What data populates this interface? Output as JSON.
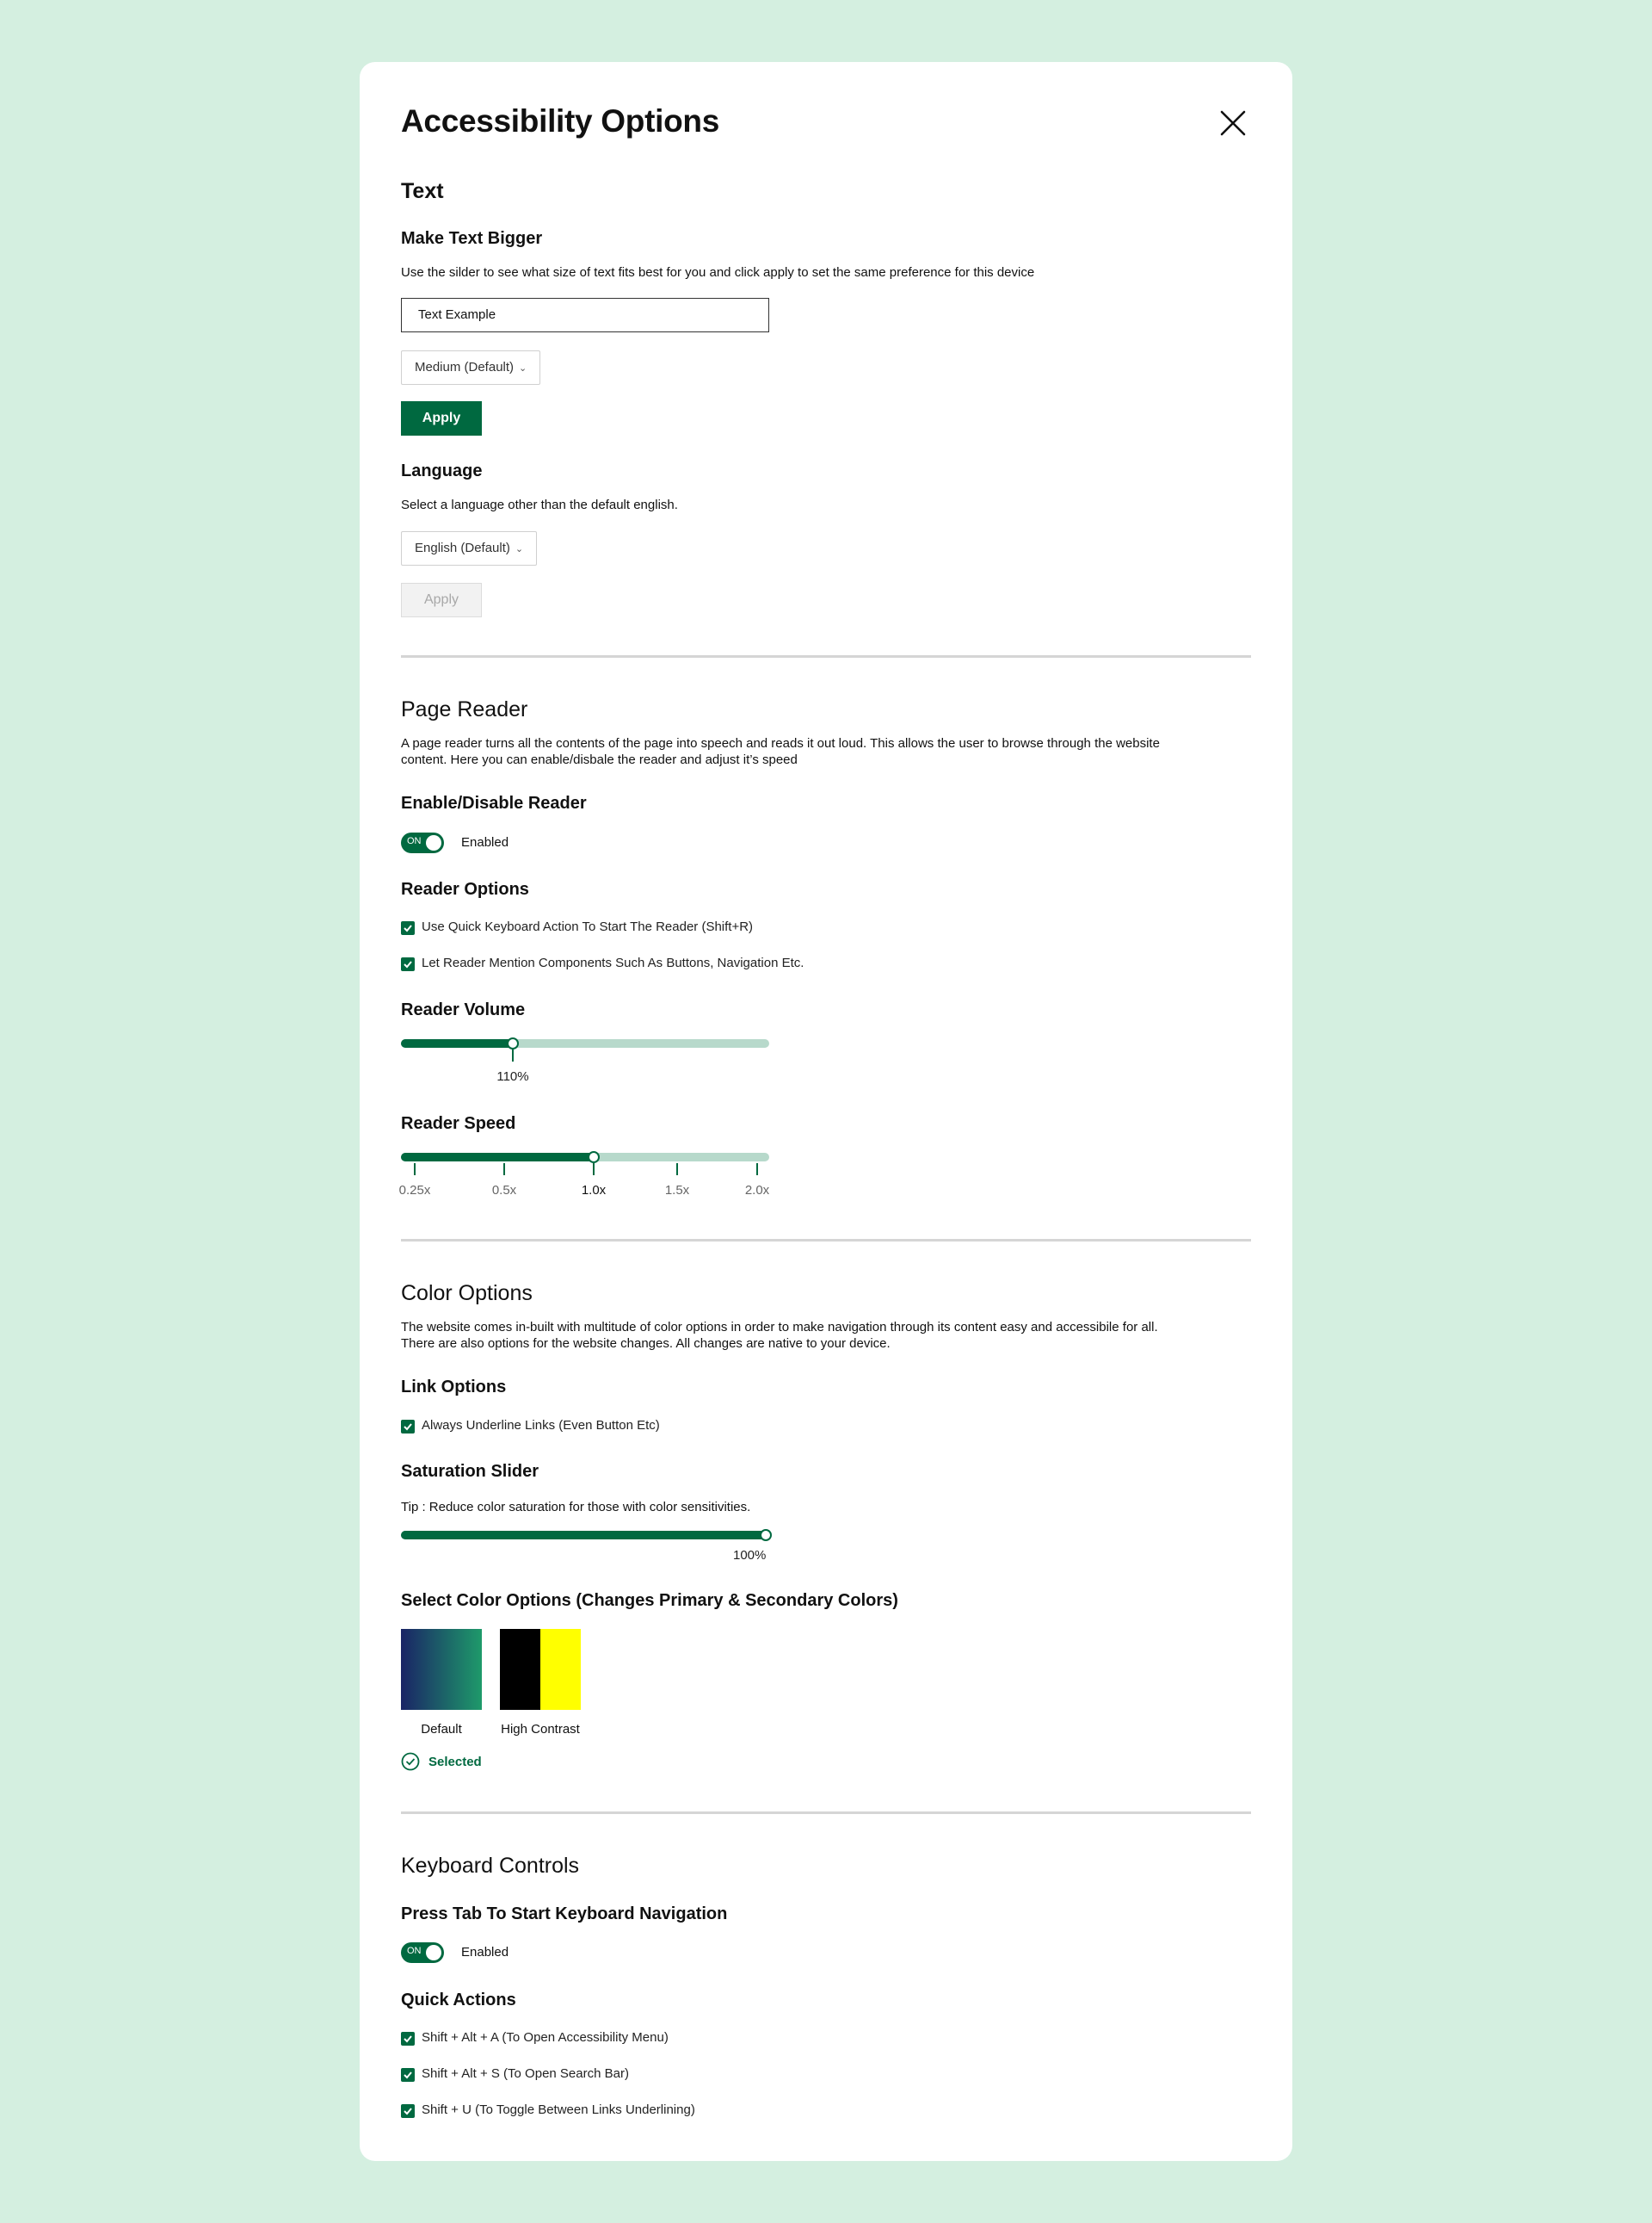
{
  "dialog": {
    "title": "Accessibility Options",
    "close_icon": "close-icon"
  },
  "text_section": {
    "heading": "Text",
    "bigger": {
      "heading": "Make Text Bigger",
      "description": "Use the silder to see what size of text fits best for you and click apply to set the same preference for this device",
      "example_value": "Text Example",
      "size_select": "Medium (Default)",
      "apply_label": "Apply"
    },
    "language": {
      "heading": "Language",
      "description": "Select a language other than the default english.",
      "language_select": "English (Default)",
      "apply_label": "Apply",
      "apply_disabled": true
    }
  },
  "page_reader": {
    "heading": "Page Reader",
    "description_line1": "A page reader turns all the contents of the page into speech and reads it out loud. This allows the user to browse through the website",
    "description_line2": "content. Here you can enable/disbale the reader and adjust it’s speed",
    "enable": {
      "heading": "Enable/Disable Reader",
      "toggle_text": "ON",
      "toggle_on": true,
      "status": "Enabled"
    },
    "options": {
      "heading": "Reader Options",
      "items": [
        {
          "label": "Use Quick Keyboard Action To Start The Reader (Shift+R)",
          "checked": true
        },
        {
          "label": "Let Reader Mention Components Such As Buttons, Navigation Etc.",
          "checked": true
        }
      ]
    },
    "volume": {
      "heading": "Reader Volume",
      "fraction": 0.3,
      "value_label": "110%"
    },
    "speed": {
      "heading": "Reader Speed",
      "ticks": [
        "0.25x",
        "0.5x",
        "1.0x",
        "1.5x",
        "2.0x"
      ],
      "selected": "1.0x"
    }
  },
  "color_options": {
    "heading": "Color Options",
    "description_line1": "The website comes in-built with multitude of color options in order to make navigation through its content easy and accessibile for all.",
    "description_line2": "There are also options for the website changes. All changes are native to your device.",
    "link_options": {
      "heading": "Link Options",
      "items": [
        {
          "label": "Always Underline Links (Even Button Etc)",
          "checked": true
        }
      ]
    },
    "saturation": {
      "heading": "Saturation Slider",
      "tip": "Tip : Reduce color saturation for those with color sensitivities.",
      "fraction": 1.0,
      "value_label": "100%"
    },
    "themes": {
      "heading": "Select Color Options (Changes Primary & Secondary Colors)",
      "items": [
        {
          "label": "Default",
          "colors": [
            "#1a2466",
            "#1e9a6a"
          ]
        },
        {
          "label": "High Contrast",
          "colors": [
            "#000000",
            "#ffff00"
          ]
        }
      ],
      "selected_label": "Selected",
      "selected_icon": "check-circle-icon"
    }
  },
  "keyboard": {
    "heading": "Keyboard Controls",
    "tab_nav": {
      "heading": "Press Tab To Start Keyboard Navigation",
      "toggle_text": "ON",
      "toggle_on": true,
      "status": "Enabled"
    },
    "quick_actions": {
      "heading": "Quick Actions",
      "items": [
        {
          "label": "Shift + Alt + A (To Open Accessibility Menu)",
          "checked": true
        },
        {
          "label": "Shift + Alt + S (To Open Search Bar)",
          "checked": true
        },
        {
          "label": "Shift + U (To Toggle Between Links Underlining)",
          "checked": true
        }
      ]
    }
  },
  "colors": {
    "background": "#d4efe0",
    "primary": "#006940",
    "track": "#b7d9cb"
  }
}
